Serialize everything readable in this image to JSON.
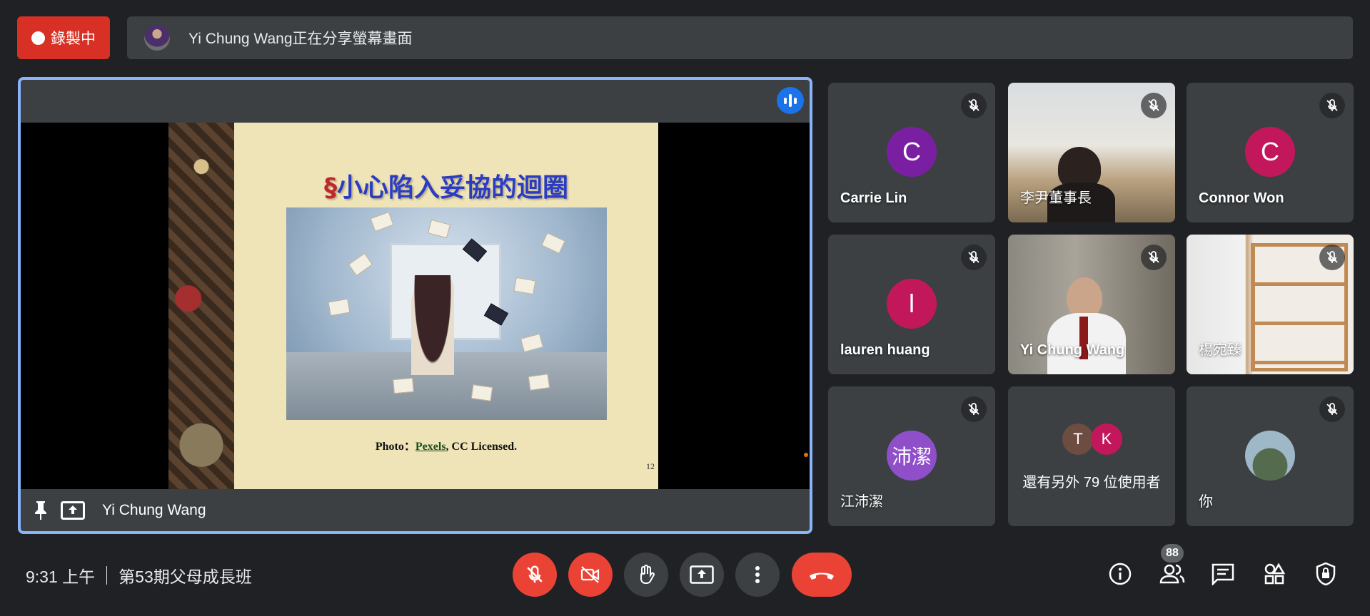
{
  "recording": {
    "label": "錄製中",
    "dot_icon": "record-dot-icon"
  },
  "share_banner": {
    "text": "Yi Chung Wang正在分享螢幕畫面"
  },
  "presentation": {
    "presenter_name": "Yi Chung Wang",
    "slide": {
      "title_symbol": "§",
      "title": "小心陷入妥協的迴圈",
      "caption_prefix": "Photo：",
      "caption_link": "Pexels",
      "caption_suffix": ", CC Licensed.",
      "page_number": "12"
    }
  },
  "participants": [
    {
      "name": "Carrie Lin",
      "initial": "C",
      "avatar_color": "#7b1fa2",
      "muted": true
    },
    {
      "name": "李尹董事長",
      "video": true,
      "muted": true
    },
    {
      "name": "Connor Won",
      "initial": "C",
      "avatar_color": "#c2185b",
      "muted": true
    },
    {
      "name": "lauren huang",
      "initial": "l",
      "avatar_color": "#c2185b",
      "muted": true
    },
    {
      "name": "Yi Chung Wang",
      "video": true,
      "muted": true
    },
    {
      "name": "楊宛臻",
      "video": true,
      "muted": true
    },
    {
      "name": "江沛潔",
      "initial": "沛潔",
      "avatar_color": "#8e4fc9",
      "muted": true
    },
    {
      "others_label": "還有另外 79 位使用者",
      "initials": [
        "T",
        "K"
      ],
      "avatar_colors": [
        "#6d4c41",
        "#c2185b"
      ]
    },
    {
      "name": "你",
      "muted": true
    }
  ],
  "bottom_bar": {
    "time": "9:31 上午",
    "meeting_name": "第53期父母成長班",
    "people_count": "88"
  },
  "colors": {
    "accent": "#8ab4f8",
    "danger": "#ea4335",
    "tile": "#3c4043",
    "background": "#202124"
  }
}
